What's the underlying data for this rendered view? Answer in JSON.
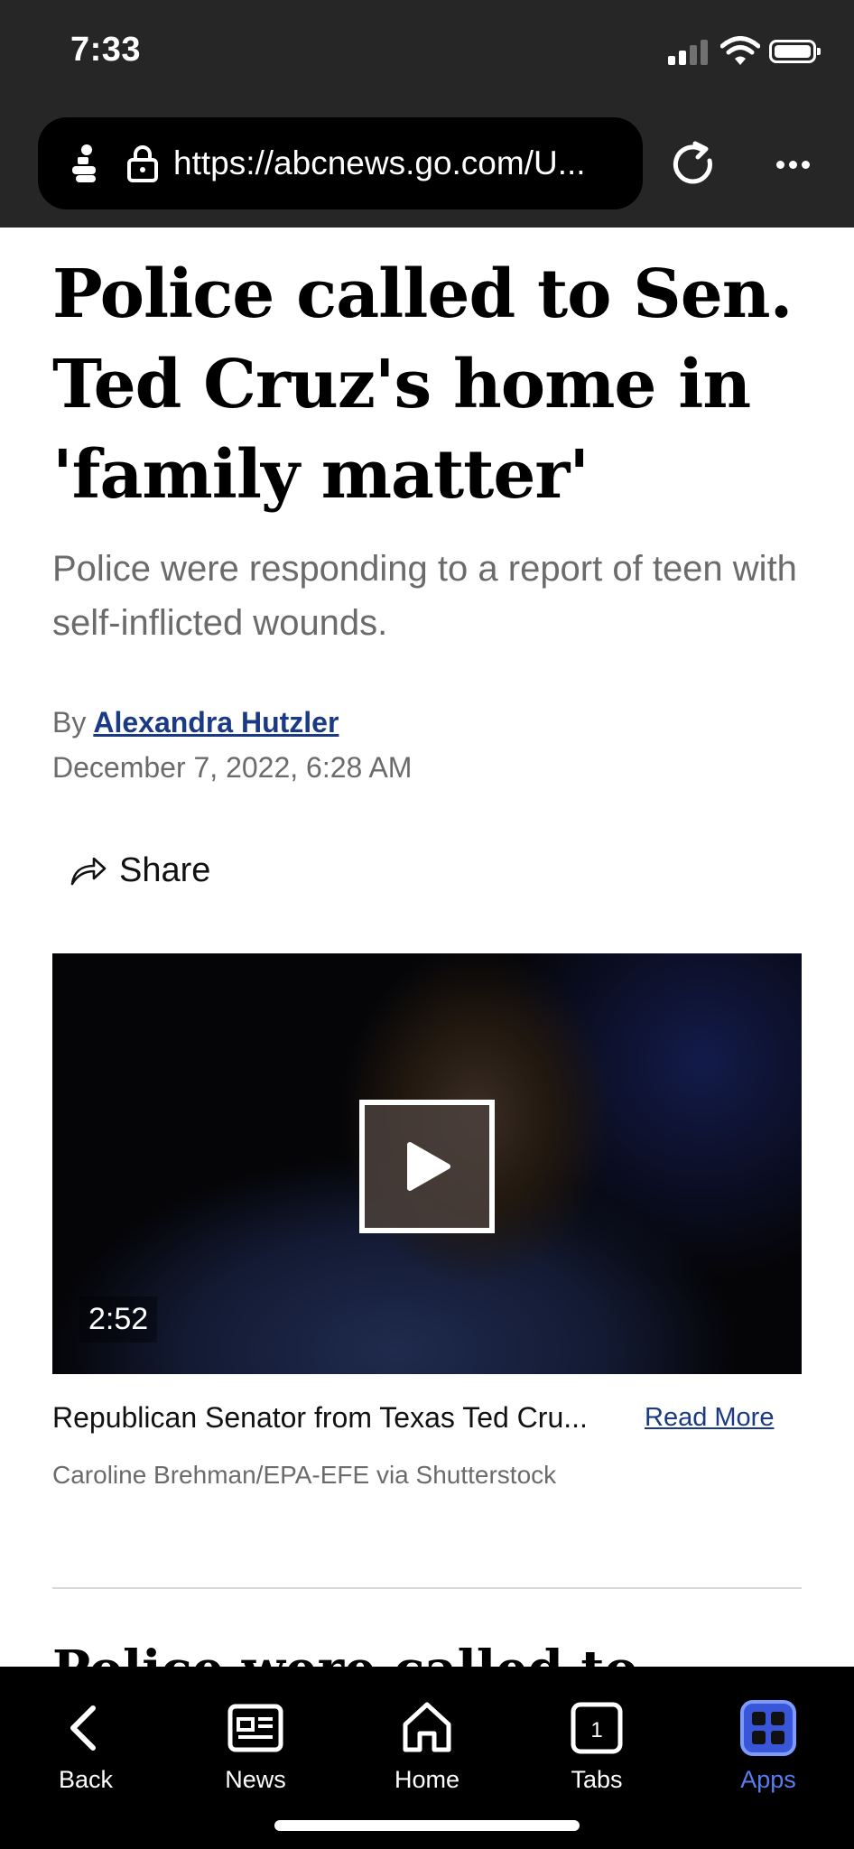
{
  "status_bar": {
    "time": "7:33"
  },
  "browser": {
    "url": "https://abcnews.go.com/U..."
  },
  "article": {
    "headline": "Police called to Sen. Ted Cruz's home in 'family matter'",
    "subhead": "Police were responding to a report of teen with self-inflicted wounds.",
    "byline_prefix": "By",
    "author": "Alexandra Hutzler",
    "date": "December 7, 2022, 6:28 AM",
    "share_label": "Share",
    "video": {
      "duration": "2:52",
      "caption": "Republican Senator from Texas Ted Cru...",
      "read_more": "Read More",
      "credit": "Caroline Brehman/EPA-EFE via Shutterstock"
    },
    "next_headline_peek": "Police were called to Texas GOP Sen."
  },
  "tabbar": {
    "items": [
      {
        "label": "Back",
        "icon": "chevron-left-icon"
      },
      {
        "label": "News",
        "icon": "newspaper-icon"
      },
      {
        "label": "Home",
        "icon": "home-icon"
      },
      {
        "label": "Tabs",
        "icon": "tabs-icon",
        "count": "1"
      },
      {
        "label": "Apps",
        "icon": "apps-grid-icon",
        "active": true
      }
    ]
  },
  "colors": {
    "chrome_bg": "#262626",
    "link": "#1b3a86",
    "active_tab": "#5a7cf0"
  }
}
